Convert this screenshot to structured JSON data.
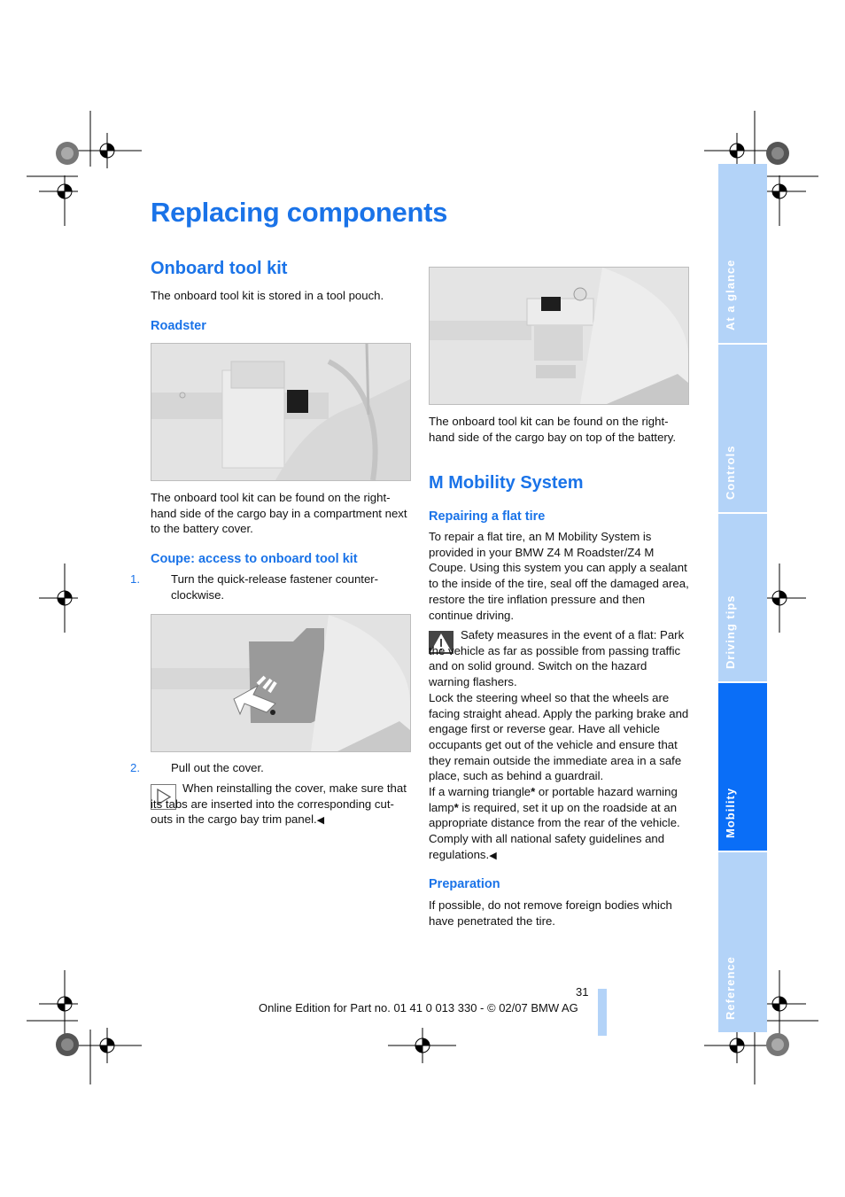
{
  "page": {
    "title": "Replacing components",
    "page_number": "31",
    "footer": "Online Edition for Part no. 01 41 0 013 330 - © 02/07 BMW AG"
  },
  "side_tabs": [
    {
      "label": "At a glance",
      "active": false
    },
    {
      "label": "Controls",
      "active": false
    },
    {
      "label": "Driving tips",
      "active": false
    },
    {
      "label": "Mobility",
      "active": true
    },
    {
      "label": "Reference",
      "active": false
    }
  ],
  "colors": {
    "accent": "#1a73e8",
    "tab_active": "#0a6ef7",
    "tab_inactive": "#b3d3f8"
  },
  "left": {
    "section_title": "Onboard tool kit",
    "intro": "The onboard tool kit is stored in a tool pouch.",
    "roadster_heading": "Roadster",
    "roadster_caption": "The onboard tool kit can be found on the right-hand side of the cargo bay in a compartment next to the battery cover.",
    "coupe_heading": "Coupe: access to onboard tool kit",
    "steps": [
      {
        "num": "1.",
        "text": "Turn the quick-release fastener counter-clockwise."
      },
      {
        "num": "2.",
        "text": "Pull out the cover."
      }
    ],
    "note_icon": "play-triangle-icon",
    "note": "When reinstalling the cover, make sure that its tabs are inserted into the corresponding cut-outs in the cargo bay trim panel.",
    "end_mark": "◀"
  },
  "right": {
    "photo_caption": "The onboard tool kit can be found on the right-hand side of the cargo bay on top of the battery.",
    "section_title": "M Mobility System",
    "repair_heading": "Repairing a flat tire",
    "repair_text": "To repair a flat tire, an M Mobility System is provided in your BMW Z4 M Roadster/Z4 M Coupe. Using this system you can apply a sealant to the inside of the tire, seal off the damaged area, restore the tire inflation pressure and then continue driving.",
    "warning_icon": "warning-triangle-icon",
    "warning_lines": [
      "Safety measures in the event of a flat: Park the vehicle as far as possible from passing traffic and on solid ground. Switch on the hazard warning flashers.",
      "Lock the steering wheel so that the wheels are facing straight ahead. Apply the parking brake and engage first or reverse gear. Have all vehicle occupants get out of the vehicle and ensure that they remain outside the immediate area in a safe place, such as behind a guardrail."
    ],
    "warning_last_a": "If a warning triangle",
    "warning_last_b": " or portable hazard warning lamp",
    "warning_last_c": " is required, set it up on the roadside at an appropriate distance from the rear of the vehicle. Comply with all national safety guidelines and regulations.",
    "asterisk": "*",
    "end_mark": "◀",
    "prep_heading": "Preparation",
    "prep_text": "If possible, do not remove foreign bodies which have penetrated the tire."
  }
}
